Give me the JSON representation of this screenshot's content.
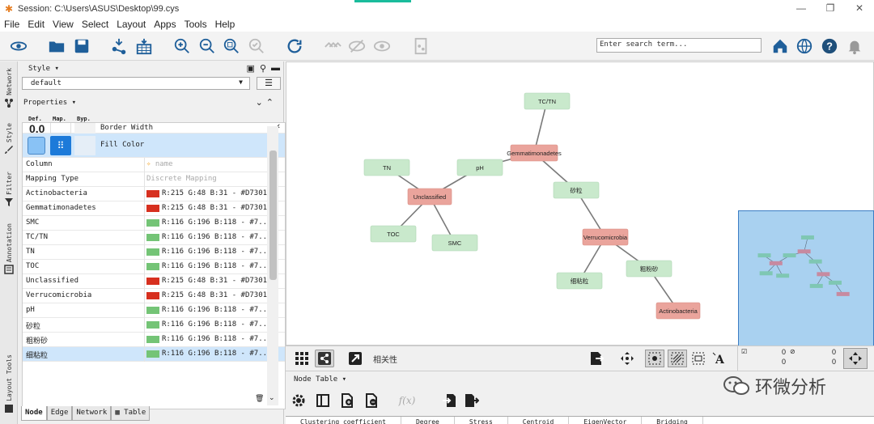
{
  "window": {
    "title": "Session: C:\\Users\\ASUS\\Desktop\\99.cys",
    "menu": [
      "File",
      "Edit",
      "View",
      "Select",
      "Layout",
      "Apps",
      "Tools",
      "Help"
    ]
  },
  "toolbar": {
    "search_placeholder": "Enter search term..."
  },
  "side_tabs": [
    "Network",
    "Style",
    "Filter",
    "Annotation",
    "Layout Tools"
  ],
  "style_panel": {
    "header": "Style",
    "style_name": "default",
    "properties_header": "Properties",
    "col_def": "Def.",
    "col_map": "Map.",
    "col_byp": "Byp.",
    "border_width_default": "0.0",
    "border_width_label": "Border Width",
    "fill_color_label": "Fill Color",
    "column_label": "Column",
    "column_value": "name",
    "mapping_type_label": "Mapping Type",
    "mapping_type_value": "Discrete Mapping",
    "mappings": [
      {
        "key": "Actinobacteria",
        "value": "R:215 G:48 B:31 - #D7301F",
        "color": "#D7301F"
      },
      {
        "key": "Gemmatimonadetes",
        "value": "R:215 G:48 B:31 - #D7301F",
        "color": "#D7301F"
      },
      {
        "key": "SMC",
        "value": "R:116 G:196 B:118 - #7...",
        "color": "#74C476"
      },
      {
        "key": "TC/TN",
        "value": "R:116 G:196 B:118 - #7...",
        "color": "#74C476"
      },
      {
        "key": "TN",
        "value": "R:116 G:196 B:118 - #7...",
        "color": "#74C476"
      },
      {
        "key": "TOC",
        "value": "R:116 G:196 B:118 - #7...",
        "color": "#74C476"
      },
      {
        "key": "Unclassified",
        "value": "R:215 G:48 B:31 - #D7301F",
        "color": "#D7301F"
      },
      {
        "key": "Verrucomicrobia",
        "value": "R:215 G:48 B:31 - #D7301F",
        "color": "#D7301F"
      },
      {
        "key": "pH",
        "value": "R:116 G:196 B:118 - #7...",
        "color": "#74C476"
      },
      {
        "key": "砂粒",
        "value": "R:116 G:196 B:118 - #7...",
        "color": "#74C476"
      },
      {
        "key": "粗粉砂",
        "value": "R:116 G:196 B:118 - #7...",
        "color": "#74C476"
      },
      {
        "key": "细粘粒",
        "value": "R:116 G:196 B:118 - #7...",
        "color": "#74C476"
      }
    ],
    "bottom_tabs": [
      "Node",
      "Edge",
      "Network",
      "Table"
    ]
  },
  "network": {
    "nodes": [
      {
        "id": "tctn",
        "label": "TC/TN",
        "kind": "green"
      },
      {
        "id": "gem",
        "label": "Gemmatimonadetes",
        "kind": "red"
      },
      {
        "id": "ph",
        "label": "pH",
        "kind": "green"
      },
      {
        "id": "tn",
        "label": "TN",
        "kind": "green"
      },
      {
        "id": "unc",
        "label": "Unclassified",
        "kind": "red"
      },
      {
        "id": "sand",
        "label": "砂粒",
        "kind": "green"
      },
      {
        "id": "toc",
        "label": "TOC",
        "kind": "green"
      },
      {
        "id": "smc",
        "label": "SMC",
        "kind": "green"
      },
      {
        "id": "ver",
        "label": "Verrucomicrobia",
        "kind": "red"
      },
      {
        "id": "silt",
        "label": "粗粉砂",
        "kind": "green"
      },
      {
        "id": "clay",
        "label": "细粘粒",
        "kind": "green"
      },
      {
        "id": "act",
        "label": "Actinobacteria",
        "kind": "red"
      }
    ],
    "edges": [
      [
        "tctn",
        "gem"
      ],
      [
        "gem",
        "ph"
      ],
      [
        "gem",
        "sand"
      ],
      [
        "ph",
        "unc"
      ],
      [
        "tn",
        "unc"
      ],
      [
        "unc",
        "toc"
      ],
      [
        "unc",
        "smc"
      ],
      [
        "sand",
        "ver"
      ],
      [
        "ver",
        "clay"
      ],
      [
        "ver",
        "silt"
      ],
      [
        "silt",
        "act"
      ]
    ],
    "colors": {
      "green_fill": "#c9e9cc",
      "red_fill": "#eaa49c",
      "edge": "#7a7a7a"
    }
  },
  "canvas_toolbar": {
    "label": "相关性",
    "counts": [
      "0",
      "0",
      "0",
      "0"
    ]
  },
  "table_panel": {
    "header": "Node Table",
    "fx": "f(x)",
    "columns": [
      "Clustering coefficient",
      "Degree",
      "Stress",
      "Centroid",
      "EigenVector",
      "Bridging"
    ]
  },
  "watermark": "环微分析"
}
